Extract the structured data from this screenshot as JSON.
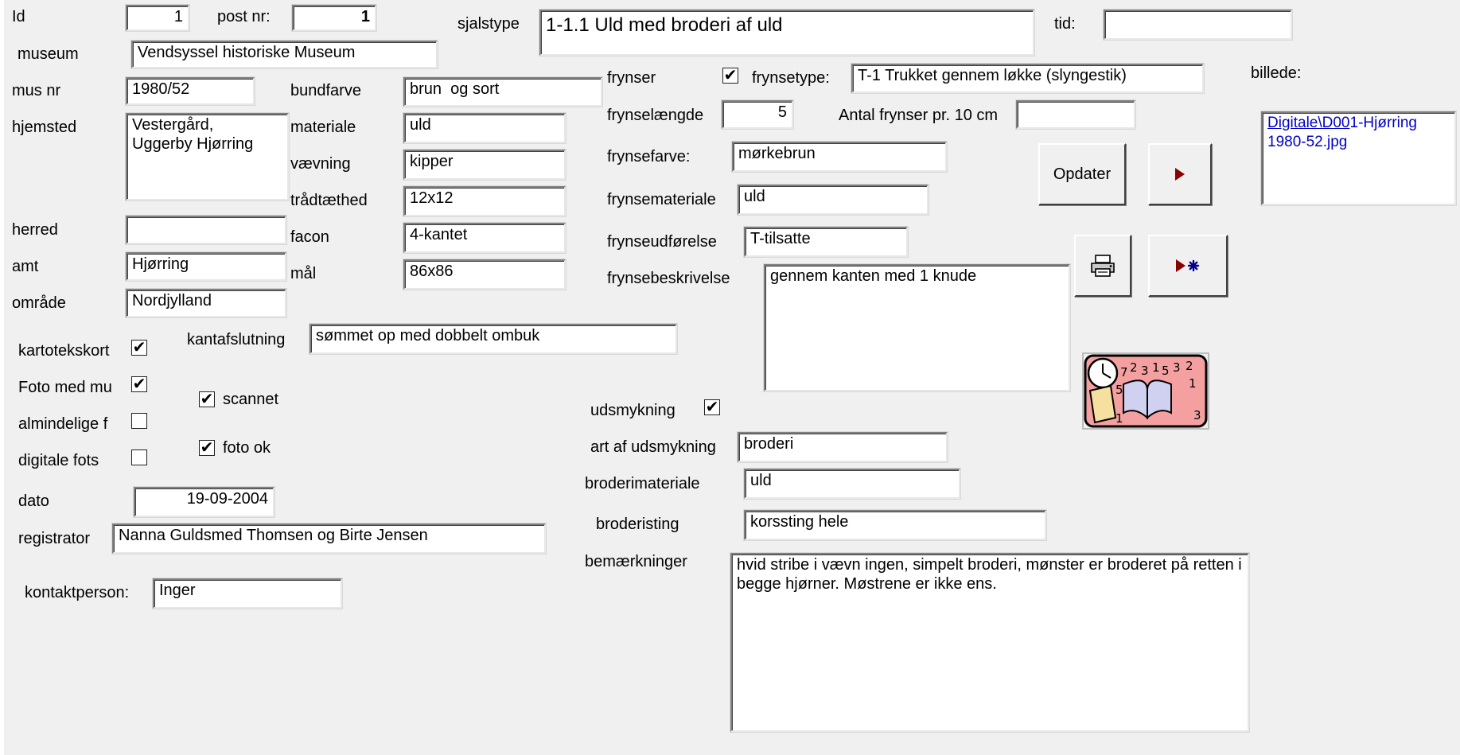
{
  "labels": {
    "id": "Id",
    "post_nr": "post nr:",
    "sjalstype": "sjalstype",
    "tid": "tid:",
    "museum": "museum",
    "frynser": "frynser",
    "frynsetype": "frynsetype:",
    "billede": "billede:",
    "mus_nr": "mus nr",
    "bundfarve": "bundfarve",
    "hjemsted": "hjemsted",
    "materiale": "materiale",
    "frynselaengde": "frynselængde",
    "antal_frynser": "Antal frynser pr. 10 cm",
    "vaevning": "vævning",
    "frynsefarve": "frynsefarve:",
    "traadtaethed": "trådtæthed",
    "frynsemateriale": "frynsemateriale",
    "herred": "herred",
    "facon": "facon",
    "frynseudfoerelse": "frynseudførelse",
    "amt": "amt",
    "maal": "mål",
    "frynsebeskrivelse": "frynsebeskrivelse",
    "omraade": "område",
    "kartotekskort": "kartotekskort",
    "kantafslutning": "kantafslutning",
    "foto_med_mu": "Foto med mu",
    "scannet": "scannet",
    "udsmykning": "udsmykning",
    "almindelige_f": "almindelige f",
    "foto_ok": "foto ok",
    "digitale_fots": "digitale fots",
    "art_af_udsmykning": "art af udsmykning",
    "broderimateriale": "broderimateriale",
    "dato": "dato",
    "broderisting": "broderisting",
    "registrator": "registrator",
    "bemaerkninger": "bemærkninger",
    "kontaktperson": "kontaktperson:"
  },
  "values": {
    "id": "1",
    "post_nr": "1",
    "sjalstype": "1-1.1 Uld med broderi af uld",
    "tid": "",
    "museum": "Vendsyssel historiske Museum",
    "frynsetype": "T-1 Trukket gennem løkke (slyngestik)",
    "mus_nr": "1980/52",
    "bundfarve": "brun  og sort",
    "hjemsted": "Vestergård,\nUggerby Hjørring",
    "materiale": "uld",
    "frynselaengde": "5",
    "antal_frynser": "",
    "vaevning": "kipper",
    "frynsefarve": "mørkebrun",
    "traadtaethed": "12x12",
    "frynsemateriale": "uld",
    "herred": "",
    "facon": "4-kantet",
    "frynseudfoerelse": "T-tilsatte",
    "amt": "Hjørring",
    "maal": "86x86",
    "frynsebeskrivelse": "gennem kanten med 1 knude",
    "omraade": "Nordjylland",
    "kantafslutning": "sømmet op med dobbelt ombuk",
    "art_af_udsmykning": "broderi",
    "broderimateriale": "uld",
    "dato": "19-09-2004",
    "broderisting": "korssting hele",
    "registrator": "Nanna Guldsmed Thomsen og Birte Jensen",
    "bemaerkninger": "hvid stribe i vævn ingen, simpelt broderi, mønster er broderet på retten i begge hjørner. Møstrene er ikke ens.",
    "kontaktperson": "Inger",
    "billede_link_underlined": "Digitale\\D00",
    "billede_link_rest": "1-Hjørring 1980-52.jpg"
  },
  "checkboxes": {
    "frynser": true,
    "kartotekskort": true,
    "foto_med_mu": true,
    "almindelige_f": false,
    "digitale_fots": false,
    "scannet": true,
    "foto_ok": true,
    "udsmykning": true
  },
  "buttons": {
    "opdater": "Opdater",
    "next_icon": "next-record-icon",
    "print_icon": "printer-icon",
    "new_record_icon": "new-record-icon",
    "clipart_icon": "clock-book-clipart-icon"
  },
  "colors": {
    "form_background": "#f0f0f0",
    "link": "#0000cc",
    "nav_arrow": "#8b0000",
    "new_record_star": "#00008b"
  }
}
